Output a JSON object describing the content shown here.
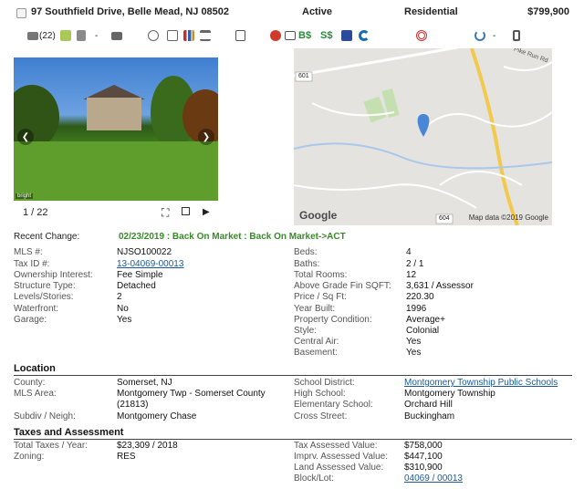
{
  "header": {
    "address": "97 Southfield Drive, Belle Mead, NJ 08502",
    "status": "Active",
    "type": "Residential",
    "price": "$799,900"
  },
  "toolbar": {
    "photo_count": "(22)",
    "dash1": "-",
    "dollar_b": "B$",
    "dollar_s": "S$",
    "dash2": "-"
  },
  "photo": {
    "counter": "1 / 22",
    "badge": "bright"
  },
  "map": {
    "google": "Google",
    "attribution": "Map data ©2019 Google",
    "road_601": "601",
    "road_604": "604",
    "road_label": "Pike Run Rd"
  },
  "recent_change": {
    "label": "Recent Change:",
    "value": "02/23/2019 : Back On Market : Back On Market->ACT"
  },
  "details_left": [
    {
      "label": "MLS #:",
      "value": "NJSO100022"
    },
    {
      "label": "Tax ID #:",
      "value": "13-04069-00013"
    },
    {
      "label": "Ownership Interest:",
      "value": "Fee Simple"
    },
    {
      "label": "Structure Type:",
      "value": "Detached"
    },
    {
      "label": "Levels/Stories:",
      "value": "2"
    },
    {
      "label": "Waterfront:",
      "value": "No"
    },
    {
      "label": "Garage:",
      "value": "Yes"
    }
  ],
  "details_right": [
    {
      "label": "Beds:",
      "value": "4"
    },
    {
      "label": "Baths:",
      "value": "2 / 1"
    },
    {
      "label": "Total Rooms:",
      "value": "12"
    },
    {
      "label": "Above Grade Fin SQFT:",
      "value": "3,631 / Assessor"
    },
    {
      "label": "Price / Sq Ft:",
      "value": "220.30"
    },
    {
      "label": "Year Built:",
      "value": "1996"
    },
    {
      "label": "Property Condition:",
      "value": "Average+"
    },
    {
      "label": "Style:",
      "value": "Colonial"
    },
    {
      "label": "Central Air:",
      "value": "Yes"
    },
    {
      "label": "Basement:",
      "value": "Yes"
    }
  ],
  "location": {
    "title": "Location",
    "left": [
      {
        "label": "County:",
        "value": "Somerset, NJ"
      },
      {
        "label": "MLS Area:",
        "value": "Montgomery Twp - Somerset County"
      },
      {
        "label": "",
        "value": "(21813)"
      },
      {
        "label": "Subdiv / Neigh:",
        "value": "Montgomery Chase"
      }
    ],
    "right": [
      {
        "label": "School District:",
        "value": "Montgomery Township Public Schools"
      },
      {
        "label": "High School:",
        "value": "Montgomery Township"
      },
      {
        "label": "Elementary School:",
        "value": "Orchard Hill"
      },
      {
        "label": "Cross Street:",
        "value": "Buckingham"
      }
    ]
  },
  "taxes": {
    "title": "Taxes and Assessment",
    "left": [
      {
        "label": "Total Taxes / Year:",
        "value": "$23,309 / 2018"
      },
      {
        "label": "Zoning:",
        "value": "RES"
      }
    ],
    "right": [
      {
        "label": "Tax Assessed Value:",
        "value": "$758,000"
      },
      {
        "label": "Imprv. Assessed Value:",
        "value": "$447,100"
      },
      {
        "label": "Land Assessed Value:",
        "value": "$310,900"
      },
      {
        "label": "Block/Lot:",
        "value": "04069 / 00013"
      }
    ]
  },
  "colors": {
    "accent_green": "#3a8a2a",
    "link_blue": "#1a5a9a"
  }
}
